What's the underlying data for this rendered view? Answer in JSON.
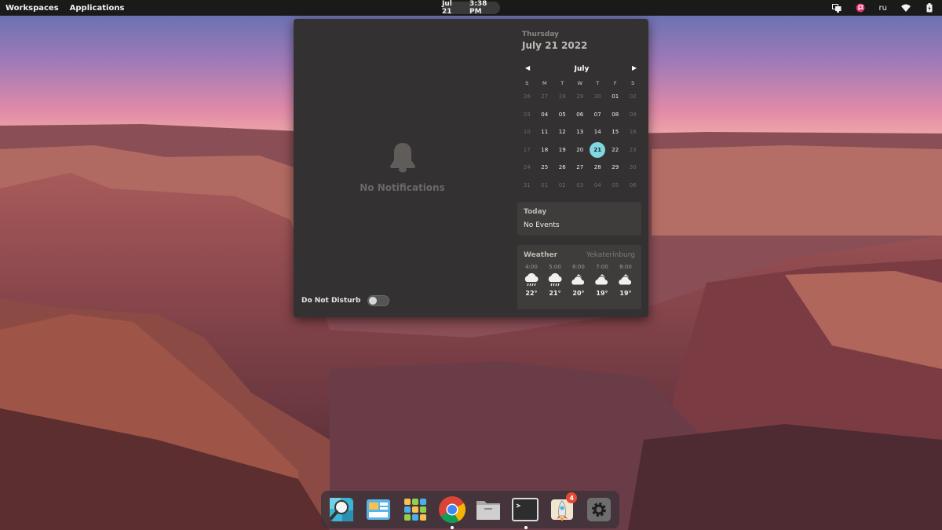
{
  "topbar": {
    "workspaces": "Workspaces",
    "applications": "Applications",
    "clock_date": "Jul 21",
    "clock_time": "3:38 PM",
    "indicators": [
      "display-icon",
      "flag-icon",
      "wifi-icon",
      "battery-icon"
    ],
    "language": "ru"
  },
  "notifications": {
    "empty_label": "No Notifications",
    "dnd_label": "Do Not Disturb",
    "dnd_enabled": false
  },
  "calendar": {
    "weekday": "Thursday",
    "full_date": "July 21 2022",
    "month": "July",
    "day_headers": [
      "S",
      "M",
      "T",
      "W",
      "T",
      "F",
      "S"
    ],
    "weeks": [
      [
        {
          "d": "26",
          "dim": true
        },
        {
          "d": "27",
          "dim": true
        },
        {
          "d": "28",
          "dim": true
        },
        {
          "d": "29",
          "dim": true
        },
        {
          "d": "30",
          "dim": true
        },
        {
          "d": "01"
        },
        {
          "d": "02",
          "dim": true
        }
      ],
      [
        {
          "d": "03",
          "dim": true
        },
        {
          "d": "04"
        },
        {
          "d": "05"
        },
        {
          "d": "06"
        },
        {
          "d": "07"
        },
        {
          "d": "08"
        },
        {
          "d": "09",
          "dim": true
        }
      ],
      [
        {
          "d": "10",
          "dim": true
        },
        {
          "d": "11"
        },
        {
          "d": "12"
        },
        {
          "d": "13"
        },
        {
          "d": "14"
        },
        {
          "d": "15"
        },
        {
          "d": "16",
          "dim": true
        }
      ],
      [
        {
          "d": "17",
          "dim": true
        },
        {
          "d": "18"
        },
        {
          "d": "19"
        },
        {
          "d": "20"
        },
        {
          "d": "21",
          "today": true
        },
        {
          "d": "22"
        },
        {
          "d": "23",
          "dim": true
        }
      ],
      [
        {
          "d": "24",
          "dim": true
        },
        {
          "d": "25"
        },
        {
          "d": "26"
        },
        {
          "d": "27"
        },
        {
          "d": "28"
        },
        {
          "d": "29"
        },
        {
          "d": "30",
          "dim": true
        }
      ],
      [
        {
          "d": "31",
          "dim": true
        },
        {
          "d": "01",
          "dim": true
        },
        {
          "d": "02",
          "dim": true
        },
        {
          "d": "03",
          "dim": true
        },
        {
          "d": "04",
          "dim": true
        },
        {
          "d": "05",
          "dim": true
        },
        {
          "d": "06",
          "dim": true
        }
      ]
    ]
  },
  "events": {
    "title": "Today",
    "body": "No Events"
  },
  "weather": {
    "title": "Weather",
    "city": "Yekaterinburg",
    "hours": [
      {
        "time": "4:00",
        "temp": "22°",
        "icon": "rain-cloud-icon"
      },
      {
        "time": "5:00",
        "temp": "21°",
        "icon": "rain-cloud-icon"
      },
      {
        "time": "6:00",
        "temp": "20°",
        "icon": "partly-cloudy-icon"
      },
      {
        "time": "7:00",
        "temp": "19°",
        "icon": "partly-cloudy-icon"
      },
      {
        "time": "8:00",
        "temp": "19°",
        "icon": "partly-cloudy-icon"
      }
    ]
  },
  "dock": {
    "apps": [
      {
        "name": "search-app-icon",
        "running": false
      },
      {
        "name": "app-center-icon",
        "running": false
      },
      {
        "name": "app-grid-icon",
        "running": false
      },
      {
        "name": "chrome-icon",
        "running": true
      },
      {
        "name": "files-icon",
        "running": false
      },
      {
        "name": "terminal-icon",
        "running": true
      },
      {
        "name": "launcher-rocket-icon",
        "running": false,
        "badge": "4"
      },
      {
        "name": "settings-icon",
        "running": false
      }
    ]
  },
  "colors": {
    "accent": "#7fd8e0",
    "panel": "#333131",
    "topbar": "#1a1a1a",
    "badge": "#e64a32"
  }
}
